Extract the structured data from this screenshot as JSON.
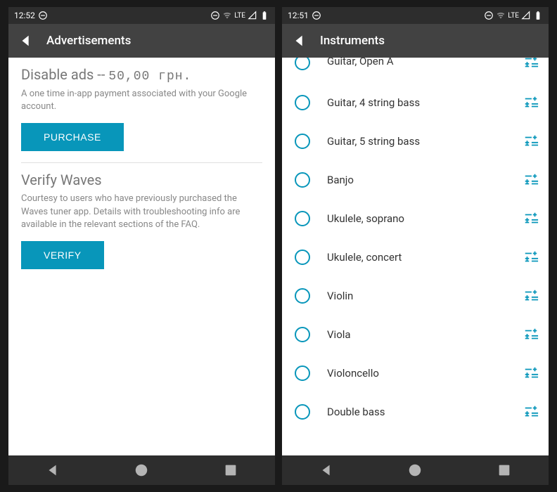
{
  "left": {
    "status": {
      "time": "12:52",
      "net": "LTE"
    },
    "appbar_title": "Advertisements",
    "section1": {
      "title": "Disable ads --",
      "price": "50,00 грн.",
      "desc": "A one time in-app payment associated with your Google account.",
      "button": "PURCHASE"
    },
    "section2": {
      "title": "Verify Waves",
      "desc": "Courtesy to users who have previously purchased the Waves tuner app. Details with troubleshooting info are available in the relevant sections of the FAQ.",
      "button": "VERIFY"
    }
  },
  "right": {
    "status": {
      "time": "12:51",
      "net": "LTE"
    },
    "appbar_title": "Instruments",
    "instruments": [
      "Guitar, Open A",
      "Guitar, 4 string bass",
      "Guitar, 5 string bass",
      "Banjo",
      "Ukulele, soprano",
      "Ukulele, concert",
      "Violin",
      "Viola",
      "Violoncello",
      "Double bass"
    ]
  }
}
